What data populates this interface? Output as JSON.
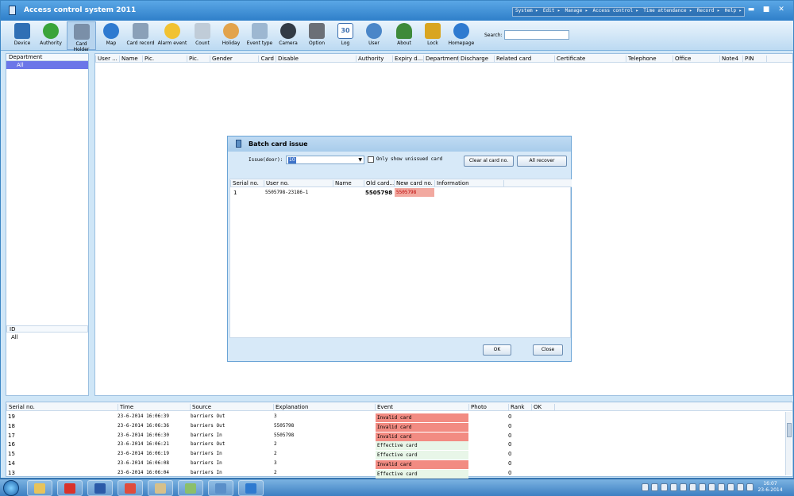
{
  "app": {
    "title": "Access control system 2011",
    "menu": [
      "System ▸",
      "Edit ▸",
      "Manage ▸",
      "Access control ▸",
      "Time attendance ▸",
      "Record ▸",
      "Help ▸"
    ]
  },
  "toolbar": {
    "buttons": [
      {
        "label": "Device",
        "icon": "monitor-icon",
        "color": "#2f6fb5"
      },
      {
        "label": "Authority",
        "icon": "refresh-icon",
        "color": "#3aa43a"
      },
      {
        "label": "Card Holder",
        "icon": "card-holder-icon",
        "color": "#7a8fa8"
      },
      {
        "label": "Map",
        "icon": "globe-icon",
        "color": "#2e7ad0"
      },
      {
        "label": "Card record",
        "icon": "table-icon",
        "color": "#8aa0b8"
      },
      {
        "label": "Alarm event",
        "icon": "bulb-icon",
        "color": "#f1c232"
      },
      {
        "label": "Count",
        "icon": "count-icon",
        "color": "#c0ccd8"
      },
      {
        "label": "Holiday",
        "icon": "clock-icon",
        "color": "#e2a34c"
      },
      {
        "label": "Event type",
        "icon": "event-type-icon",
        "color": "#9db7d1"
      },
      {
        "label": "Camera",
        "icon": "camera-icon",
        "color": "#333b45"
      },
      {
        "label": "Option",
        "icon": "tools-icon",
        "color": "#6b6f76"
      },
      {
        "label": "Log",
        "icon": "calendar-icon",
        "color": "#3b6fb0"
      },
      {
        "label": "User",
        "icon": "user-icon",
        "color": "#4a86c8"
      },
      {
        "label": "About",
        "icon": "tree-icon",
        "color": "#3e8a3a"
      },
      {
        "label": "Lock",
        "icon": "lock-icon",
        "color": "#d9a520"
      },
      {
        "label": "Homepage",
        "icon": "globe-icon",
        "color": "#2e7ad0"
      }
    ],
    "search_label": "Search:",
    "search_value": "",
    "calendar_day": "30"
  },
  "left_panel": {
    "header": "Department",
    "selected": "All",
    "id_header": "ID",
    "id_value": "All"
  },
  "main_grid": {
    "columns": [
      "User ...",
      "Name",
      "Pic.",
      "Pic.",
      "Gender",
      "Card",
      "Disable",
      "Authority",
      "Expiry d...",
      "Department",
      "Discharge",
      "Related card",
      "Certificate",
      "Telephone",
      "Office",
      "Note4",
      "PIN"
    ]
  },
  "dialog": {
    "title": "Batch card issue",
    "issue_label": "Issue(door):",
    "issue_value": "10",
    "checkbox_label": "Only show unissued card",
    "clear_button": "Clear al card no.",
    "recover_button": "All recover",
    "columns": [
      "Serial no.",
      "User no.",
      "Name",
      "Old card...",
      "New card no.",
      "Information"
    ],
    "rows": [
      {
        "serial": "1",
        "user_no": "5505798-23186-1",
        "name": "",
        "old_card": "5505798",
        "new_card": "5505798",
        "information": ""
      }
    ],
    "ok_button": "OK",
    "close_button": "Close"
  },
  "event_log": {
    "columns": [
      "Serial no.",
      "Time",
      "Source",
      "Explanation",
      "Event",
      "Photo",
      "Rank",
      "OK"
    ],
    "rows": [
      {
        "serial": "19",
        "time": "23-6-2014 16:06:39",
        "source": "barriers Out",
        "explanation": "3",
        "event": "Invalid card",
        "status": "invalid",
        "rank": "0"
      },
      {
        "serial": "18",
        "time": "23-6-2014 16:06:36",
        "source": "barriers Out",
        "explanation": "5505798",
        "event": "Invalid card",
        "status": "invalid",
        "rank": "0"
      },
      {
        "serial": "17",
        "time": "23-6-2014 16:06:30",
        "source": "barriers In",
        "explanation": "5505798",
        "event": "Invalid card",
        "status": "invalid",
        "rank": "0"
      },
      {
        "serial": "16",
        "time": "23-6-2014 16:06:21",
        "source": "barriers Out",
        "explanation": "2",
        "event": "Effective card",
        "status": "effective",
        "rank": "0"
      },
      {
        "serial": "15",
        "time": "23-6-2014 16:06:19",
        "source": "barriers In",
        "explanation": "2",
        "event": "Effective card",
        "status": "effective",
        "rank": "0"
      },
      {
        "serial": "14",
        "time": "23-6-2014 16:06:08",
        "source": "barriers In",
        "explanation": "3",
        "event": "Invalid card",
        "status": "invalid",
        "rank": "0"
      },
      {
        "serial": "13",
        "time": "23-6-2014 16:06:04",
        "source": "barriers In",
        "explanation": "2",
        "event": "Effective card",
        "status": "effective",
        "rank": "0"
      }
    ],
    "colors": {
      "invalid": "#f28b82",
      "effective": "#e8f6e8"
    }
  },
  "taskbar": {
    "apps": [
      {
        "icon": "folder-icon",
        "color": "#e8c35a"
      },
      {
        "icon": "pdf-icon",
        "color": "#d9322a"
      },
      {
        "icon": "word-icon",
        "color": "#2b5aa8"
      },
      {
        "icon": "chrome-icon",
        "color": "#e04c3c"
      },
      {
        "icon": "explorer-icon",
        "color": "#d7c08a"
      },
      {
        "icon": "checklist-icon",
        "color": "#8bbf6a"
      },
      {
        "icon": "picture-icon",
        "color": "#5a8fc9"
      },
      {
        "icon": "globe-icon",
        "color": "#2e7ad0"
      }
    ],
    "time": "16:07",
    "date": "23-6-2014"
  }
}
